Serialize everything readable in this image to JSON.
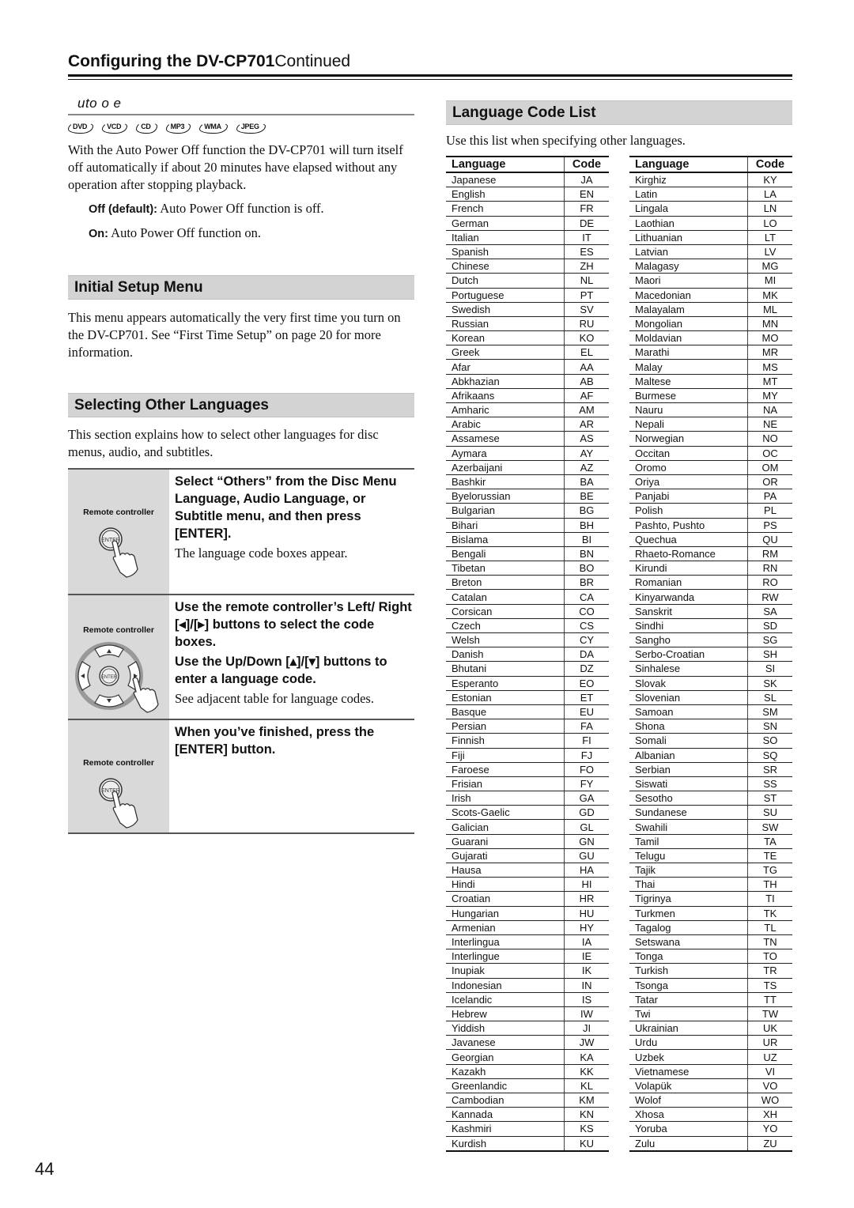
{
  "header": {
    "title_bold": "Configuring the DV-CP701",
    "title_normal": "Continued"
  },
  "auto_power_off": {
    "heading": "uto   o   e",
    "disc_icons": [
      "DVD",
      "VCD",
      "CD",
      "MP3",
      "WMA",
      "JPEG"
    ],
    "description": "With the Auto Power Off function the DV-CP701 will turn itself off automatically if about 20 minutes have elapsed without any operation after stopping playback.",
    "options": [
      {
        "label": "Off (default):",
        "text": " Auto Power Off function is off."
      },
      {
        "label": "On:",
        "text": " Auto Power Off function on."
      }
    ]
  },
  "initial_setup": {
    "heading": "Initial Setup Menu",
    "text": "This menu appears automatically the very first time you turn on the DV-CP701. See “First Time Setup” on page 20 for more information."
  },
  "selecting_languages": {
    "heading": "Selecting Other Languages",
    "text": "This section explains how to select other languages for disc menus, audio, and subtitles.",
    "steps": [
      {
        "graphic_label": "Remote controller",
        "graphic_button": "ENTER",
        "heading": "Select “Others” from the Disc Menu Language, Audio Language, or Subtitle menu, and then press [ENTER].",
        "note": "The language code boxes appear."
      },
      {
        "graphic_label": "Remote controller",
        "graphic_button": "ENTER",
        "heading": "Use the remote controller’s Left/ Right [◂]/[▸] buttons to select the code boxes.",
        "heading2": "Use the Up/Down [▴]/[▾] buttons to enter a language code.",
        "note": "See adjacent table for language codes."
      },
      {
        "graphic_label": "Remote controller",
        "graphic_button": "ENTER",
        "heading": "When you’ve finished, press the [ENTER] button."
      }
    ]
  },
  "language_code_list": {
    "heading": "Language Code List",
    "intro": "Use this list when specifying other languages.",
    "columns": [
      "Language",
      "Code"
    ],
    "left_table": [
      [
        "Japanese",
        "JA"
      ],
      [
        "English",
        "EN"
      ],
      [
        "French",
        "FR"
      ],
      [
        "German",
        "DE"
      ],
      [
        "Italian",
        "IT"
      ],
      [
        "Spanish",
        "ES"
      ],
      [
        "Chinese",
        "ZH"
      ],
      [
        "Dutch",
        "NL"
      ],
      [
        "Portuguese",
        "PT"
      ],
      [
        "Swedish",
        "SV"
      ],
      [
        "Russian",
        "RU"
      ],
      [
        "Korean",
        "KO"
      ],
      [
        "Greek",
        "EL"
      ],
      [
        "Afar",
        "AA"
      ],
      [
        "Abkhazian",
        "AB"
      ],
      [
        "Afrikaans",
        "AF"
      ],
      [
        "Amharic",
        "AM"
      ],
      [
        "Arabic",
        "AR"
      ],
      [
        "Assamese",
        "AS"
      ],
      [
        "Aymara",
        "AY"
      ],
      [
        "Azerbaijani",
        "AZ"
      ],
      [
        "Bashkir",
        "BA"
      ],
      [
        "Byelorussian",
        "BE"
      ],
      [
        "Bulgarian",
        "BG"
      ],
      [
        "Bihari",
        "BH"
      ],
      [
        "Bislama",
        "BI"
      ],
      [
        "Bengali",
        "BN"
      ],
      [
        "Tibetan",
        "BO"
      ],
      [
        "Breton",
        "BR"
      ],
      [
        "Catalan",
        "CA"
      ],
      [
        "Corsican",
        "CO"
      ],
      [
        "Czech",
        "CS"
      ],
      [
        "Welsh",
        "CY"
      ],
      [
        "Danish",
        "DA"
      ],
      [
        "Bhutani",
        "DZ"
      ],
      [
        "Esperanto",
        "EO"
      ],
      [
        "Estonian",
        "ET"
      ],
      [
        "Basque",
        "EU"
      ],
      [
        "Persian",
        "FA"
      ],
      [
        "Finnish",
        "FI"
      ],
      [
        "Fiji",
        "FJ"
      ],
      [
        "Faroese",
        "FO"
      ],
      [
        "Frisian",
        "FY"
      ],
      [
        "Irish",
        "GA"
      ],
      [
        "Scots-Gaelic",
        "GD"
      ],
      [
        "Galician",
        "GL"
      ],
      [
        "Guarani",
        "GN"
      ],
      [
        "Gujarati",
        "GU"
      ],
      [
        "Hausa",
        "HA"
      ],
      [
        "Hindi",
        "HI"
      ],
      [
        "Croatian",
        "HR"
      ],
      [
        "Hungarian",
        "HU"
      ],
      [
        "Armenian",
        "HY"
      ],
      [
        "Interlingua",
        "IA"
      ],
      [
        "Interlingue",
        "IE"
      ],
      [
        "Inupiak",
        "IK"
      ],
      [
        "Indonesian",
        "IN"
      ],
      [
        "Icelandic",
        "IS"
      ],
      [
        "Hebrew",
        "IW"
      ],
      [
        "Yiddish",
        "JI"
      ],
      [
        "Javanese",
        "JW"
      ],
      [
        "Georgian",
        "KA"
      ],
      [
        "Kazakh",
        "KK"
      ],
      [
        "Greenlandic",
        "KL"
      ],
      [
        "Cambodian",
        "KM"
      ],
      [
        "Kannada",
        "KN"
      ],
      [
        "Kashmiri",
        "KS"
      ],
      [
        "Kurdish",
        "KU"
      ]
    ],
    "right_table": [
      [
        "Kirghiz",
        "KY"
      ],
      [
        "Latin",
        "LA"
      ],
      [
        "Lingala",
        "LN"
      ],
      [
        "Laothian",
        "LO"
      ],
      [
        "Lithuanian",
        "LT"
      ],
      [
        "Latvian",
        "LV"
      ],
      [
        "Malagasy",
        "MG"
      ],
      [
        "Maori",
        "MI"
      ],
      [
        "Macedonian",
        "MK"
      ],
      [
        "Malayalam",
        "ML"
      ],
      [
        "Mongolian",
        "MN"
      ],
      [
        "Moldavian",
        "MO"
      ],
      [
        "Marathi",
        "MR"
      ],
      [
        "Malay",
        "MS"
      ],
      [
        "Maltese",
        "MT"
      ],
      [
        "Burmese",
        "MY"
      ],
      [
        "Nauru",
        "NA"
      ],
      [
        "Nepali",
        "NE"
      ],
      [
        "Norwegian",
        "NO"
      ],
      [
        "Occitan",
        "OC"
      ],
      [
        "Oromo",
        "OM"
      ],
      [
        "Oriya",
        "OR"
      ],
      [
        "Panjabi",
        "PA"
      ],
      [
        "Polish",
        "PL"
      ],
      [
        "Pashto, Pushto",
        "PS"
      ],
      [
        "Quechua",
        "QU"
      ],
      [
        "Rhaeto-Romance",
        "RM"
      ],
      [
        "Kirundi",
        "RN"
      ],
      [
        "Romanian",
        "RO"
      ],
      [
        "Kinyarwanda",
        "RW"
      ],
      [
        "Sanskrit",
        "SA"
      ],
      [
        "Sindhi",
        "SD"
      ],
      [
        "Sangho",
        "SG"
      ],
      [
        "Serbo-Croatian",
        "SH"
      ],
      [
        "Sinhalese",
        "SI"
      ],
      [
        "Slovak",
        "SK"
      ],
      [
        "Slovenian",
        "SL"
      ],
      [
        "Samoan",
        "SM"
      ],
      [
        "Shona",
        "SN"
      ],
      [
        "Somali",
        "SO"
      ],
      [
        "Albanian",
        "SQ"
      ],
      [
        "Serbian",
        "SR"
      ],
      [
        "Siswati",
        "SS"
      ],
      [
        "Sesotho",
        "ST"
      ],
      [
        "Sundanese",
        "SU"
      ],
      [
        "Swahili",
        "SW"
      ],
      [
        "Tamil",
        "TA"
      ],
      [
        "Telugu",
        "TE"
      ],
      [
        "Tajik",
        "TG"
      ],
      [
        "Thai",
        "TH"
      ],
      [
        "Tigrinya",
        "TI"
      ],
      [
        "Turkmen",
        "TK"
      ],
      [
        "Tagalog",
        "TL"
      ],
      [
        "Setswana",
        "TN"
      ],
      [
        "Tonga",
        "TO"
      ],
      [
        "Turkish",
        "TR"
      ],
      [
        "Tsonga",
        "TS"
      ],
      [
        "Tatar",
        "TT"
      ],
      [
        "Twi",
        "TW"
      ],
      [
        "Ukrainian",
        "UK"
      ],
      [
        "Urdu",
        "UR"
      ],
      [
        "Uzbek",
        "UZ"
      ],
      [
        "Vietnamese",
        "VI"
      ],
      [
        "Volapük",
        "VO"
      ],
      [
        "Wolof",
        "WO"
      ],
      [
        "Xhosa",
        "XH"
      ],
      [
        "Yoruba",
        "YO"
      ],
      [
        "Zulu",
        "ZU"
      ]
    ]
  },
  "footer": {
    "page_number": "44"
  }
}
